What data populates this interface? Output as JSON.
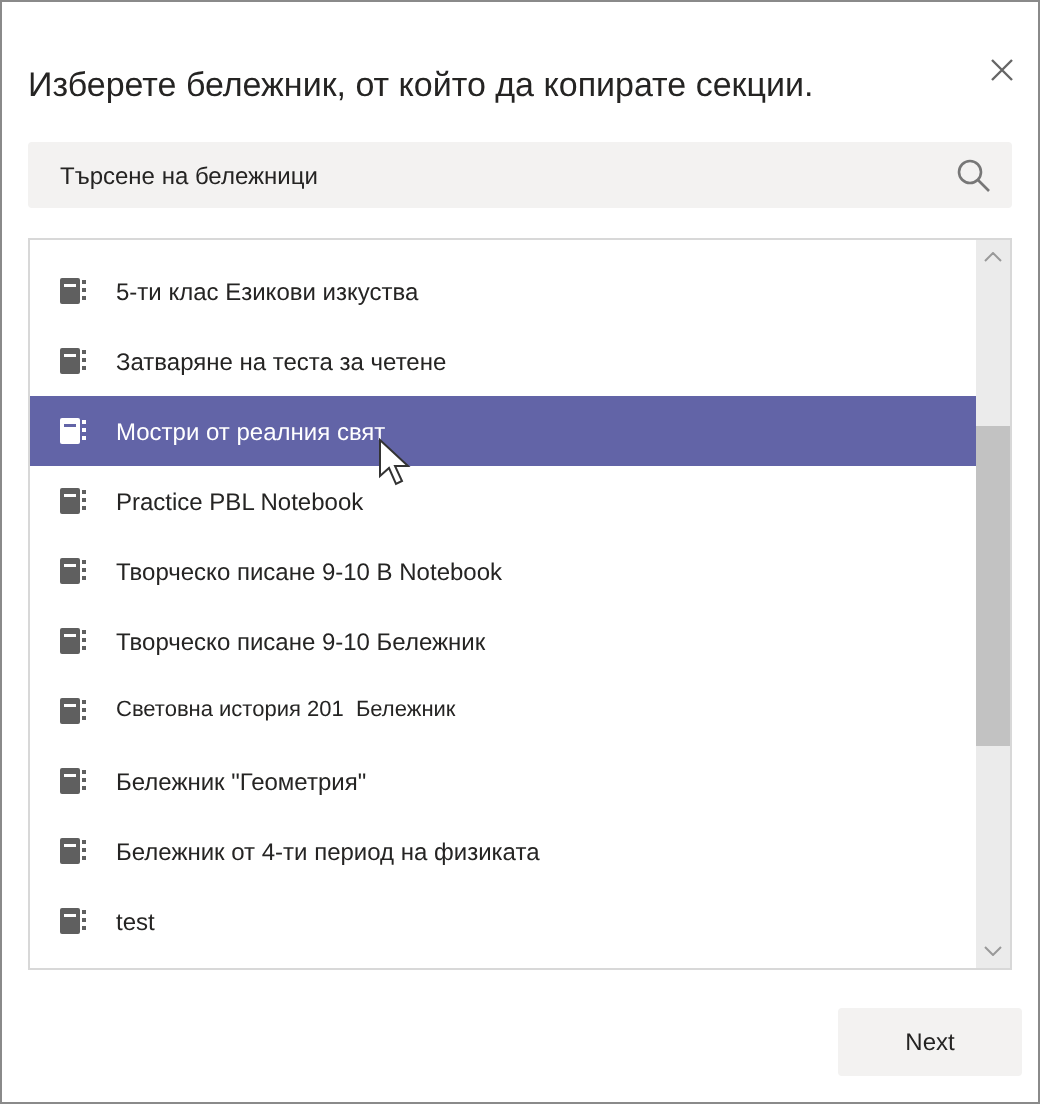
{
  "dialog": {
    "title": "Изберете бележник, от който да копирате секции."
  },
  "search": {
    "placeholder": "Търсене на бележници"
  },
  "notebooks": [
    {
      "name": "5-ти клас Езикови изкуства",
      "selected": false
    },
    {
      "name": "Затваряне на теста за четене",
      "selected": false
    },
    {
      "name": "Мостри от реалния свят",
      "selected": true
    },
    {
      "name": "Practice PBL Notebook",
      "selected": false
    },
    {
      "name": "Творческо писане 9-10 B Notebook",
      "selected": false
    },
    {
      "name": "Творческо писане 9-10 Бележник",
      "selected": false
    },
    {
      "name": "Световна история 201  Бележник",
      "selected": false,
      "small": true
    },
    {
      "name": "Бележник \"Геометрия\"",
      "selected": false
    },
    {
      "name": "Бележник от 4-ти период на физиката",
      "selected": false
    },
    {
      "name": "test",
      "selected": false
    }
  ],
  "buttons": {
    "next": "Next"
  }
}
